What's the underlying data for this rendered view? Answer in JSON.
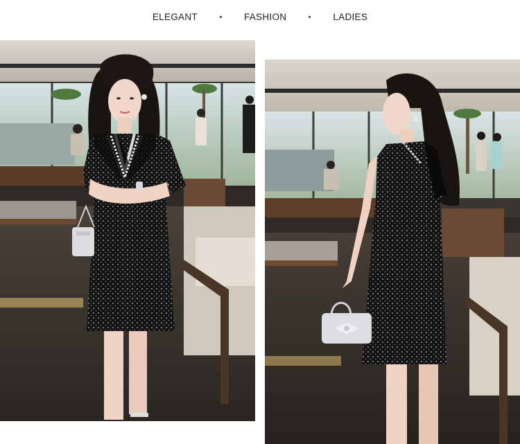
{
  "header": {
    "tags": [
      "ELEGANT",
      "FASHION",
      "LADIES"
    ]
  },
  "photos": [
    {
      "name": "model-front-view",
      "subject": "woman in black sparkle dress with crystal collar, holding silver handbag"
    },
    {
      "name": "model-side-view",
      "subject": "woman in black sparkle dress holding silver bow handbag"
    }
  ],
  "colors": {
    "background": "#ffffff",
    "dress": "#151515",
    "text": "#222222"
  }
}
